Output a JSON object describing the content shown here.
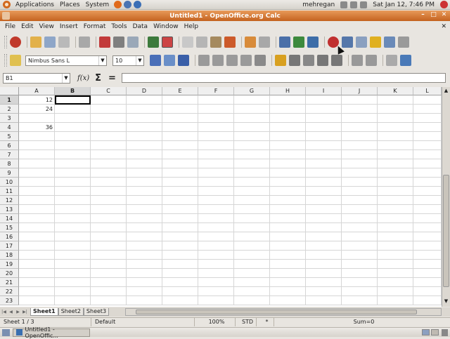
{
  "top_panel": {
    "menus": [
      "Applications",
      "Places",
      "System"
    ],
    "user": "mehregan",
    "datetime": "Sat Jan 12,  7:46 PM"
  },
  "window": {
    "title": "Untitled1 - OpenOffice.org Calc"
  },
  "menubar": {
    "items": [
      "File",
      "Edit",
      "View",
      "Insert",
      "Format",
      "Tools",
      "Data",
      "Window",
      "Help"
    ],
    "close_glyph": "✕"
  },
  "toolbar1": {
    "icons": [
      "new-document-icon",
      "open-folder-icon",
      "save-icon",
      "email-icon",
      "edit-file-icon",
      "export-pdf-icon",
      "print-icon",
      "print-preview-icon",
      "spellcheck-icon",
      "autospellcheck-icon",
      "cut-icon",
      "copy-icon",
      "paste-icon",
      "format-paintbrush-icon",
      "undo-icon",
      "redo-icon",
      "hyperlink-icon",
      "sort-ascending-icon",
      "sort-descending-icon",
      "chart-icon",
      "draw-functions-icon",
      "find-icon",
      "navigator-icon",
      "gallery-icon",
      "datasources-icon"
    ]
  },
  "toolbar2": {
    "font_name": "Nimbus Sans L",
    "font_size": "10",
    "icons": [
      "styles-icon",
      "bold-icon",
      "italic-icon",
      "underline-icon",
      "align-left-icon",
      "align-center-icon",
      "align-right-icon",
      "justify-icon",
      "merge-cells-icon",
      "currency-icon",
      "percent-icon",
      "standard-format-icon",
      "add-decimal-icon",
      "remove-decimal-icon",
      "decrease-indent-icon",
      "increase-indent-icon",
      "borders-icon",
      "background-color-icon"
    ]
  },
  "formula_bar": {
    "name_box": "B1",
    "fx": "f(x)",
    "sigma": "Σ",
    "equals": "=",
    "input": ""
  },
  "grid": {
    "columns": [
      "A",
      "B",
      "C",
      "D",
      "E",
      "F",
      "G",
      "H",
      "I",
      "J",
      "K",
      "L"
    ],
    "rows": [
      "1",
      "2",
      "3",
      "4",
      "5",
      "6",
      "7",
      "8",
      "9",
      "10",
      "11",
      "12",
      "13",
      "14",
      "15",
      "16",
      "17",
      "18",
      "19",
      "20",
      "21",
      "22",
      "23"
    ],
    "selected_column": "B",
    "selected_row": "1",
    "cells": {
      "A1": "12",
      "A2": "24",
      "A4": "36"
    }
  },
  "sheet_tabs": [
    "Sheet1",
    "Sheet2",
    "Sheet3"
  ],
  "active_sheet": "Sheet1",
  "statusbar": {
    "sheet": "Sheet 1 / 3",
    "style": "Default",
    "zoom": "100%",
    "mode": "STD",
    "modified": "*",
    "sum": "Sum=0"
  },
  "taskbar": {
    "task": "Untitled1 - OpenOffic..."
  },
  "colors": {
    "titlebar": "#c4621f",
    "panel": "#dcd8d1"
  }
}
